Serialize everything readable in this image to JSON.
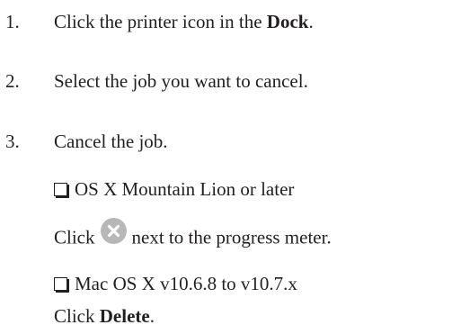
{
  "steps": [
    {
      "number": "1.",
      "text_before": "Click the printer icon in the ",
      "bold": "Dock",
      "text_after": "."
    },
    {
      "number": "2.",
      "text": "Select the job you want to cancel."
    },
    {
      "number": "3.",
      "text": "Cancel the job."
    }
  ],
  "options": [
    {
      "label": "OS X Mountain Lion or later",
      "instruction_before": "Click",
      "icon": "cancel-x-circle-icon",
      "instruction_after": "next to the progress meter."
    },
    {
      "label": "Mac OS X v10.6.8 to v10.7.x",
      "instruction_before": "Click ",
      "bold": "Delete",
      "instruction_after": "."
    }
  ],
  "colors": {
    "text": "#231f20",
    "icon_fill": "#b7b7b7",
    "icon_x": "#ffffff"
  }
}
